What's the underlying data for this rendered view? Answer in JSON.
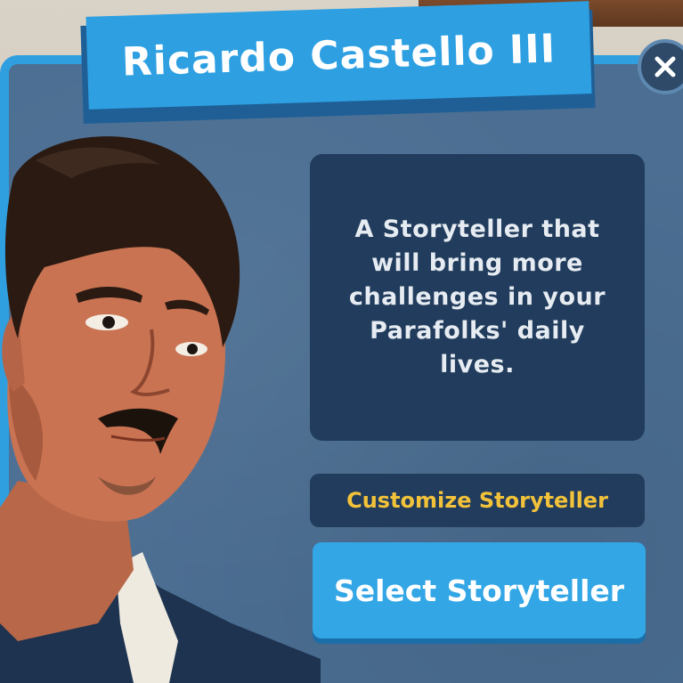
{
  "dialog": {
    "title": "Ricardo Castello III",
    "description": "A Storyteller that will bring more challenges in your Parafolks' daily lives.",
    "customize_label": "Customize Storyteller",
    "select_label": "Select Storyteller",
    "close_icon": "close-icon"
  },
  "colors": {
    "panel": "#4b6e92",
    "banner": "#2ea0e2",
    "description_box": "#213c5c",
    "customize_text": "#f2c23a",
    "select_button": "#33a6e6"
  }
}
